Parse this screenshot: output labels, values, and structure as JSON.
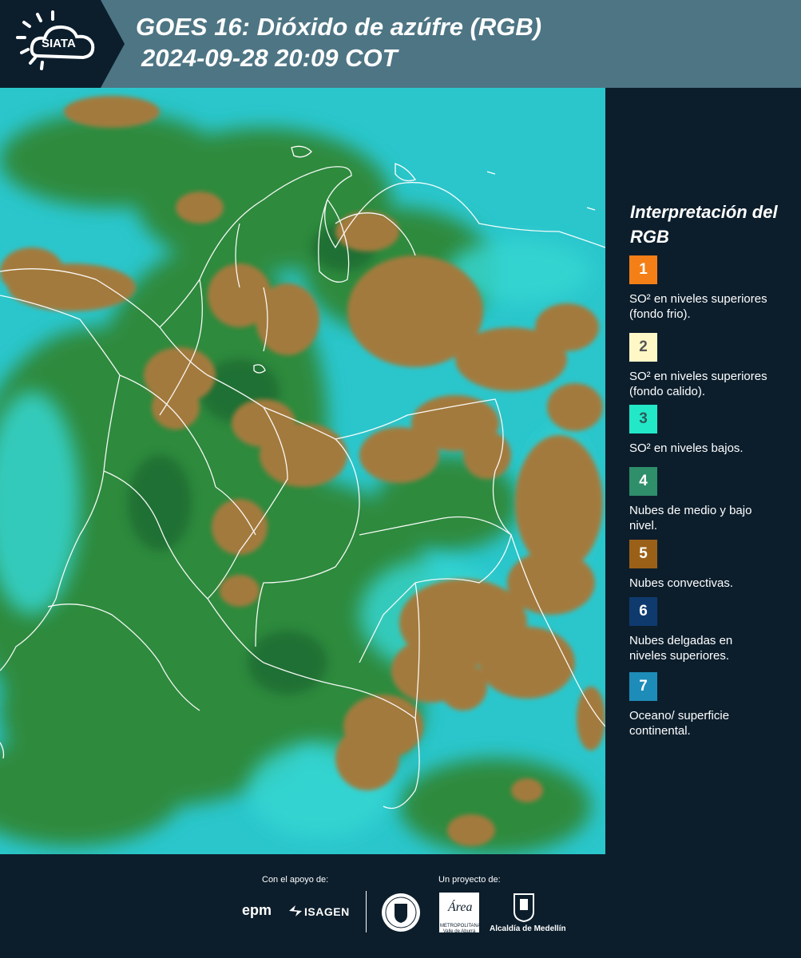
{
  "header": {
    "logo_text": "SIATA",
    "title_line1": "GOES 16: Dióxido de azúfre (RGB)",
    "title_line2": "2024-09-28 20:09 COT"
  },
  "legend": {
    "title": "Interpretación del RGB",
    "items": [
      {
        "num": "1",
        "color": "#f57f17",
        "num_color": "#ffffff",
        "text": "SO² en niveles superiores (fondo frio)."
      },
      {
        "num": "2",
        "color": "#fff8c6",
        "num_color": "#555555",
        "text": "SO² en niveles superiores (fondo calido)."
      },
      {
        "num": "3",
        "color": "#22e8c8",
        "num_color": "#2d5a5a",
        "text": "SO² en niveles bajos."
      },
      {
        "num": "4",
        "color": "#2e8f6a",
        "num_color": "#ffffff",
        "text": "Nubes de medio y bajo nivel."
      },
      {
        "num": "5",
        "color": "#9b6018",
        "num_color": "#ffffff",
        "text": "Nubes convectivas."
      },
      {
        "num": "6",
        "color": "#0f3a6e",
        "num_color": "#ffffff",
        "text": "Nubes delgadas en niveles superiores."
      },
      {
        "num": "7",
        "color": "#1e8cb8",
        "num_color": "#ffffff",
        "text": "Oceano/ superficie continental."
      }
    ]
  },
  "footer": {
    "support_label": "Con el apoyo de:",
    "project_label": "Un proyecto de:",
    "epm": "epm",
    "isagen": "ISAGEN",
    "area_word": "Área",
    "area_sub": "METROPOLITANA Valle de Aburrá",
    "alcaldia": "Alcaldía de Medellín"
  },
  "colors": {
    "header_bg": "#4e7584",
    "panel_bg": "#0c1e2c",
    "cloud_convective": "#a37a3c",
    "surface_cyan": "#2ac6cc",
    "vegetation_green": "#2f8a3e"
  }
}
